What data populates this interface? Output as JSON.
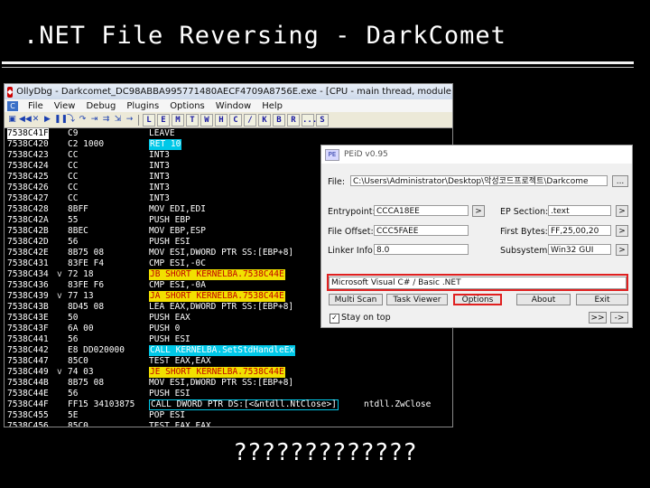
{
  "slide": {
    "title": ".NET File Reversing - DarkComet",
    "caption": "?????????????"
  },
  "ollydbg": {
    "title": "OllyDbg - Darkcomet_DC98ABBA995771480AECF4709A8756E.exe - [CPU - main thread, module KERNELBA]",
    "menu": [
      "File",
      "View",
      "Debug",
      "Plugins",
      "Options",
      "Window",
      "Help"
    ],
    "toolbar_letters": [
      "L",
      "E",
      "M",
      "T",
      "W",
      "H",
      "C",
      "/",
      "K",
      "B",
      "R",
      "...",
      "S"
    ],
    "rows": [
      {
        "addr": "7538C41F",
        "mark": "",
        "hex": "C9",
        "dis": "LEAVE",
        "hl": "",
        "sel": true
      },
      {
        "addr": "7538C420",
        "mark": "",
        "hex": "C2 1000",
        "dis": "RET 10",
        "hl": "cyan"
      },
      {
        "addr": "7538C423",
        "mark": "",
        "hex": "CC",
        "dis": "INT3",
        "hl": ""
      },
      {
        "addr": "7538C424",
        "mark": "",
        "hex": "CC",
        "dis": "INT3",
        "hl": ""
      },
      {
        "addr": "7538C425",
        "mark": "",
        "hex": "CC",
        "dis": "INT3",
        "hl": ""
      },
      {
        "addr": "7538C426",
        "mark": "",
        "hex": "CC",
        "dis": "INT3",
        "hl": ""
      },
      {
        "addr": "7538C427",
        "mark": "",
        "hex": "CC",
        "dis": "INT3",
        "hl": ""
      },
      {
        "addr": "7538C428",
        "mark": "",
        "hex": "8BFF",
        "dis": "MOV EDI,EDI",
        "hl": ""
      },
      {
        "addr": "7538C42A",
        "mark": "",
        "hex": "55",
        "dis": "PUSH EBP",
        "hl": ""
      },
      {
        "addr": "7538C42B",
        "mark": "",
        "hex": "8BEC",
        "dis": "MOV EBP,ESP",
        "hl": ""
      },
      {
        "addr": "7538C42D",
        "mark": "",
        "hex": "56",
        "dis": "PUSH ESI",
        "hl": ""
      },
      {
        "addr": "7538C42E",
        "mark": "",
        "hex": "8B75 08",
        "dis": "MOV ESI,DWORD PTR SS:[EBP+8]",
        "hl": ""
      },
      {
        "addr": "7538C431",
        "mark": "",
        "hex": "83FE F4",
        "dis": "CMP ESI,-0C",
        "hl": ""
      },
      {
        "addr": "7538C434",
        "mark": "v",
        "hex": "72 18",
        "dis": "JB SHORT KERNELBA.7538C44E",
        "hl": "yellow"
      },
      {
        "addr": "7538C436",
        "mark": "",
        "hex": "83FE F6",
        "dis": "CMP ESI,-0A",
        "hl": ""
      },
      {
        "addr": "7538C439",
        "mark": "v",
        "hex": "77 13",
        "dis": "JA SHORT KERNELBA.7538C44E",
        "hl": "yellow"
      },
      {
        "addr": "7538C43B",
        "mark": "",
        "hex": "8D45 08",
        "dis": "LEA EAX,DWORD PTR SS:[EBP+8]",
        "hl": ""
      },
      {
        "addr": "7538C43E",
        "mark": "",
        "hex": "50",
        "dis": "PUSH EAX",
        "hl": ""
      },
      {
        "addr": "7538C43F",
        "mark": "",
        "hex": "6A 00",
        "dis": "PUSH 0",
        "hl": ""
      },
      {
        "addr": "7538C441",
        "mark": "",
        "hex": "56",
        "dis": "PUSH ESI",
        "hl": ""
      },
      {
        "addr": "7538C442",
        "mark": "",
        "hex": "E8 DD020000",
        "dis": "CALL KERNELBA.SetStdHandleEx",
        "hl": "cyan"
      },
      {
        "addr": "7538C447",
        "mark": "",
        "hex": "85C0",
        "dis": "TEST EAX,EAX",
        "hl": ""
      },
      {
        "addr": "7538C449",
        "mark": "v",
        "hex": "74 03",
        "dis": "JE SHORT KERNELBA.7538C44E",
        "hl": "yellow"
      },
      {
        "addr": "7538C44B",
        "mark": "",
        "hex": "8B75 08",
        "dis": "MOV ESI,DWORD PTR SS:[EBP+8]",
        "hl": ""
      },
      {
        "addr": "7538C44E",
        "mark": "",
        "hex": "56",
        "dis": "PUSH ESI",
        "hl": ""
      },
      {
        "addr": "7538C44F",
        "mark": "",
        "hex": "FF15 34103875",
        "dis": "CALL DWORD PTR DS:[<&ntdll.NtClose>]",
        "hl": "blue",
        "comment": "ntdll.ZwClose"
      },
      {
        "addr": "7538C455",
        "mark": "",
        "hex": "5E",
        "dis": "POP ESI",
        "hl": ""
      },
      {
        "addr": "7538C456",
        "mark": "",
        "hex": "85C0",
        "dis": "TEST EAX,EAX",
        "hl": ""
      }
    ]
  },
  "peid": {
    "title": "PEiD v0.95",
    "file_label": "File:",
    "file_value": "C:\\Users\\Administrator\\Desktop\\악성코드프로젝트\\Darkcome",
    "browse_label": "...",
    "entrypoint_label": "Entrypoint:",
    "entrypoint_value": "CCCA18EE",
    "ep_section_label": "EP Section:",
    "ep_section_value": ".text",
    "file_offset_label": "File Offset:",
    "file_offset_value": "CCC5FAEE",
    "first_bytes_label": "First Bytes:",
    "first_bytes_value": "FF,25,00,20",
    "linker_label": "Linker Info:",
    "linker_value": "8.0",
    "subsystem_label": "Subsystem:",
    "subsystem_value": "Win32 GUI",
    "arrow_label": ">",
    "detection": "Microsoft Visual C# / Basic .NET",
    "buttons": {
      "multi_scan": "Multi Scan",
      "task_viewer": "Task Viewer",
      "options": "Options",
      "about": "About",
      "exit": "Exit"
    },
    "stay_on_top": "Stay on top",
    "bottom_btn_left": ">>",
    "bottom_btn_right": "->"
  }
}
